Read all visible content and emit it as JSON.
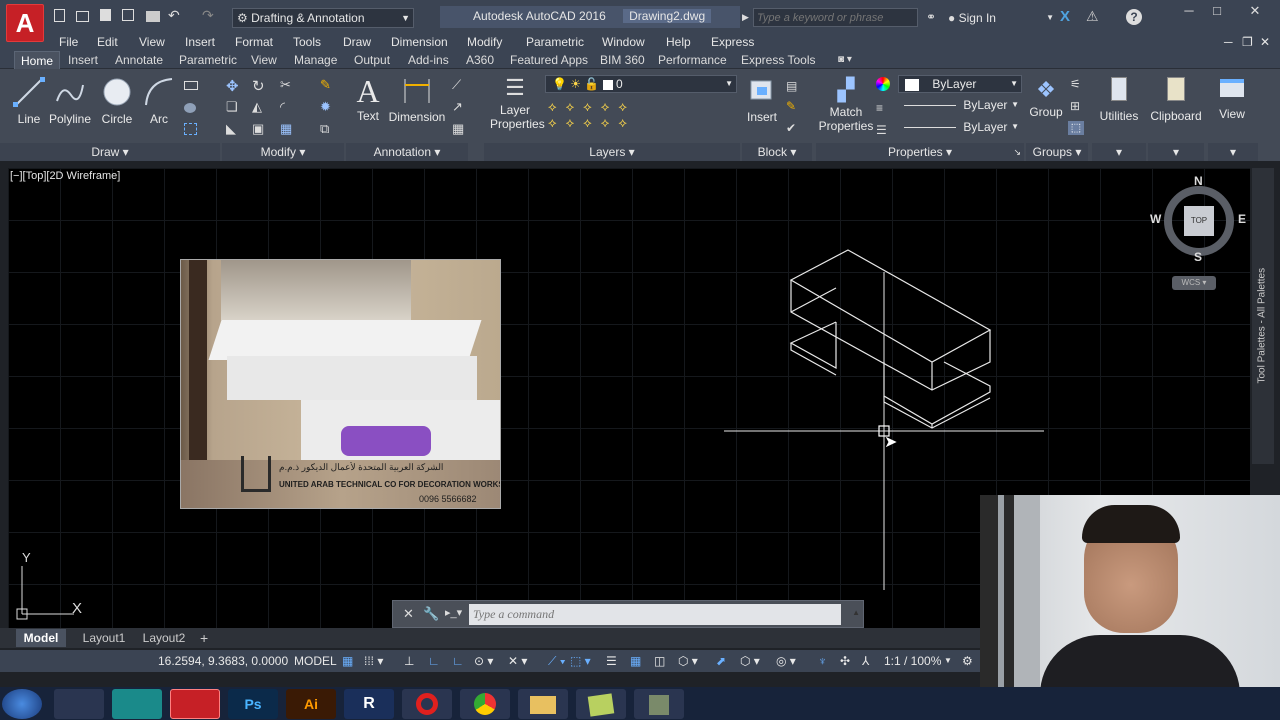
{
  "titlebar": {
    "workspace": "Drafting & Annotation",
    "app": "Autodesk AutoCAD 2016",
    "file": "Drawing2.dwg",
    "search_placeholder": "Type a keyword or phrase",
    "sign_in": "Sign In"
  },
  "menu": [
    "File",
    "Edit",
    "View",
    "Insert",
    "Format",
    "Tools",
    "Draw",
    "Dimension",
    "Modify",
    "Parametric",
    "Window",
    "Help",
    "Express"
  ],
  "ribbon_tabs": [
    "Home",
    "Insert",
    "Annotate",
    "Parametric",
    "View",
    "Manage",
    "Output",
    "Add-ins",
    "A360",
    "Featured Apps",
    "BIM 360",
    "Performance",
    "Express Tools"
  ],
  "draw": {
    "line": "Line",
    "polyline": "Polyline",
    "circle": "Circle",
    "arc": "Arc",
    "panel": "Draw"
  },
  "modify": {
    "panel": "Modify"
  },
  "annotation": {
    "text": "Text",
    "dimension": "Dimension",
    "panel": "Annotation"
  },
  "layers": {
    "layer_properties": "Layer Properties",
    "current": "0",
    "panel": "Layers"
  },
  "block": {
    "insert": "Insert",
    "panel": "Block"
  },
  "properties": {
    "match": "Match Properties",
    "color": "ByLayer",
    "linetype": "ByLayer",
    "lineweight": "ByLayer",
    "panel": "Properties"
  },
  "groups": {
    "group": "Group",
    "panel": "Groups"
  },
  "utilities": {
    "label": "Utilities"
  },
  "clipboard": {
    "label": "Clipboard"
  },
  "view": {
    "label": "View"
  },
  "viewport": {
    "label": "[−][Top][2D Wireframe]"
  },
  "viewcube": {
    "n": "N",
    "s": "S",
    "e": "E",
    "w": "W",
    "top": "TOP",
    "wcs": "WCS"
  },
  "ucs": {
    "y": "Y",
    "x": "X"
  },
  "command": {
    "placeholder": "Type a command"
  },
  "layout_tabs": [
    "Model",
    "Layout1",
    "Layout2"
  ],
  "status": {
    "coords": "16.2594, 9.3683, 0.0000",
    "model": "MODEL",
    "scale": "1:1 / 100%"
  },
  "palette": "Tool Palettes - All Palettes",
  "image_watermark": {
    "arabic": "الشركة العربية المتحدة لأعمال الديكور ذ.م.م",
    "english": "UNITED ARAB TECHNICAL CO FOR DECORATION WORKS LLC",
    "phone": "0096 5566682"
  }
}
